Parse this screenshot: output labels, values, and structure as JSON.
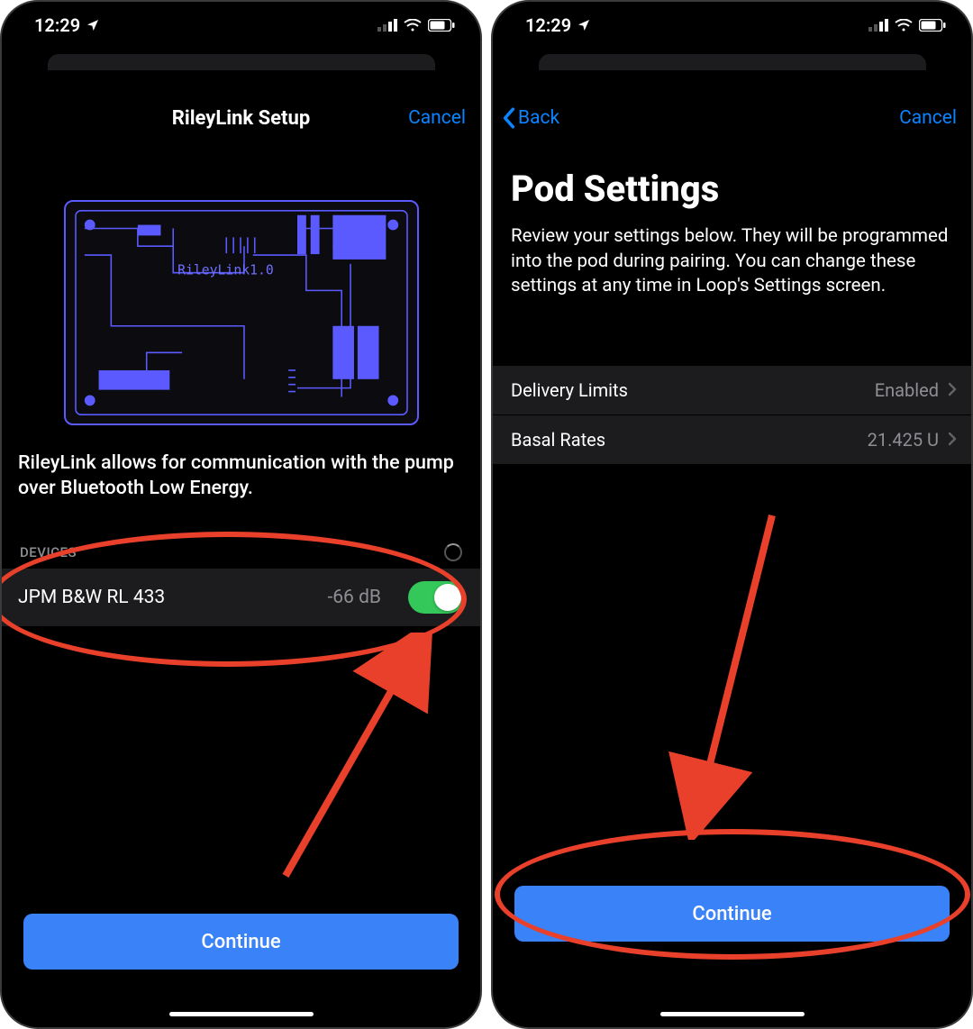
{
  "status": {
    "time": "12:29",
    "location_active": true
  },
  "screen1": {
    "nav_title": "RileyLink Setup",
    "cancel_label": "Cancel",
    "pcb_label": "RileyLink1.0",
    "description": "RileyLink allows for communication with the pump over Bluetooth Low Energy.",
    "section_header": "DEVICES",
    "device": {
      "name": "JPM B&W RL 433",
      "signal": "-66 dB",
      "enabled": true
    },
    "continue_label": "Continue"
  },
  "screen2": {
    "back_label": "Back",
    "cancel_label": "Cancel",
    "title": "Pod Settings",
    "description": "Review your settings below. They will be programmed into the pod during pairing. You can change these settings at any time in Loop's Settings screen.",
    "rows": [
      {
        "label": "Delivery Limits",
        "value": "Enabled"
      },
      {
        "label": "Basal Rates",
        "value": "21.425 U"
      }
    ],
    "continue_label": "Continue"
  }
}
